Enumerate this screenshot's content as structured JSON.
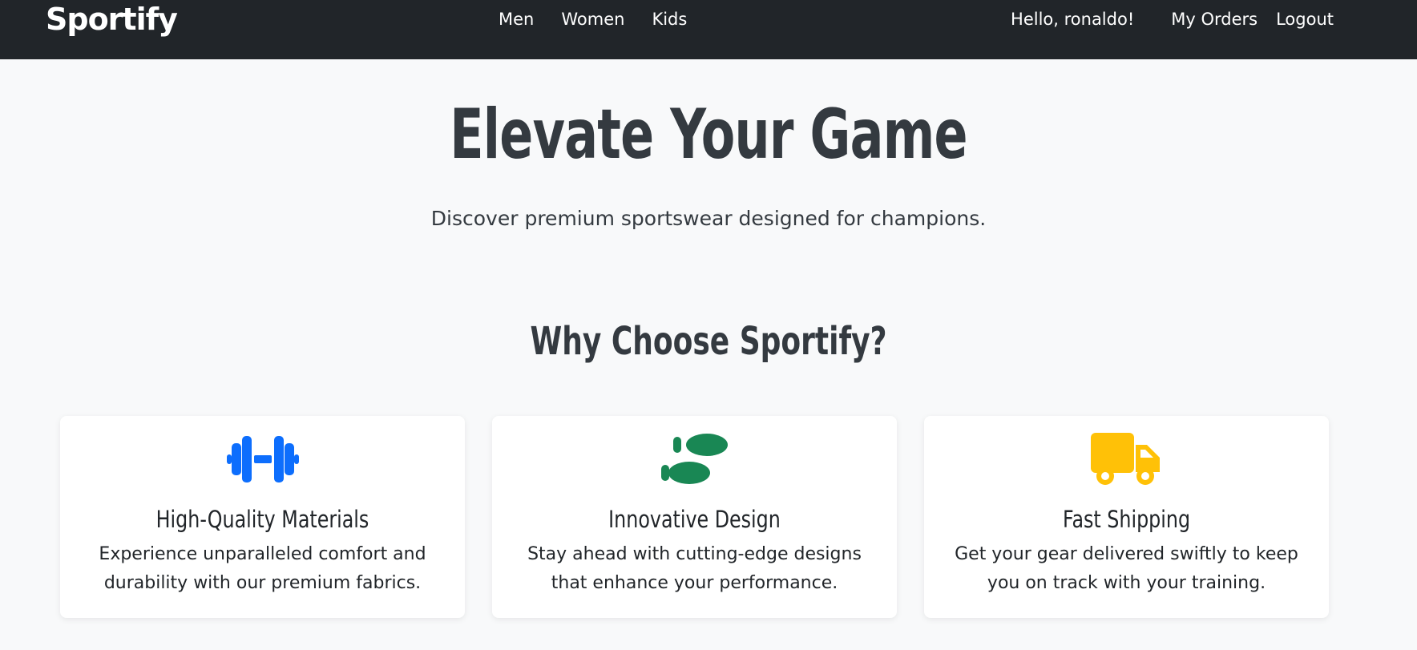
{
  "navbar": {
    "brand": "Sportify",
    "links": [
      "Men",
      "Women",
      "Kids"
    ],
    "greeting": "Hello, ronaldo!",
    "orders": "My Orders",
    "logout": "Logout"
  },
  "hero": {
    "title": "Elevate Your Game",
    "subtitle": "Discover premium sportswear designed for champions."
  },
  "features": {
    "title": "Why Choose Sportify?",
    "items": [
      {
        "icon": "dumbbell-icon",
        "color": "#0d6efd",
        "title": "High-Quality Materials",
        "text": "Experience unparalleled comfort and durability with our premium fabrics."
      },
      {
        "icon": "shoe-prints-icon",
        "color": "#198754",
        "title": "Innovative Design",
        "text": "Stay ahead with cutting-edge designs that enhance your performance."
      },
      {
        "icon": "truck-icon",
        "color": "#ffc107",
        "title": "Fast Shipping",
        "text": "Get your gear delivered swiftly to keep you on track with your training."
      }
    ]
  },
  "colors": {
    "navbar_bg": "#212529",
    "page_bg": "#f8f9fa",
    "text_dark": "#343a40"
  }
}
